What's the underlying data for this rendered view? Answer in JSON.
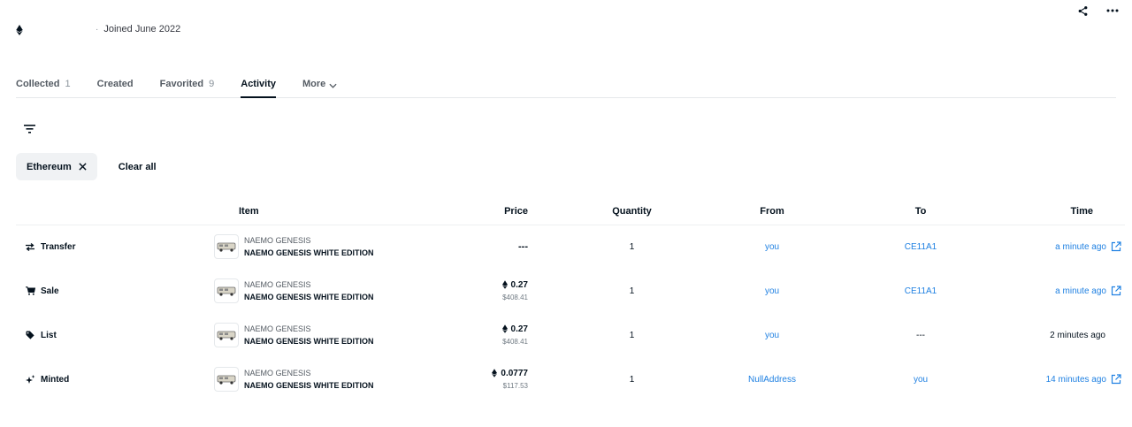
{
  "profile": {
    "joined": "Joined June 2022"
  },
  "tabs": [
    {
      "label": "Collected",
      "count": "1"
    },
    {
      "label": "Created",
      "count": ""
    },
    {
      "label": "Favorited",
      "count": "9"
    },
    {
      "label": "Activity",
      "count": ""
    },
    {
      "label": "More",
      "count": ""
    }
  ],
  "filters": {
    "chip_label": "Ethereum",
    "clear_label": "Clear all"
  },
  "table": {
    "headers": {
      "item": "Item",
      "price": "Price",
      "quantity": "Quantity",
      "from": "From",
      "to": "To",
      "time": "Time"
    },
    "rows": [
      {
        "event": "Transfer",
        "icon": "transfer-icon",
        "collection": "NAEMO GENESIS",
        "item_name": "NAEMO GENESIS WHITE EDITION",
        "price_eth": "---",
        "price_usd": "",
        "quantity": "1",
        "from": "you",
        "to": "CE11A1",
        "time": "a minute ago"
      },
      {
        "event": "Sale",
        "icon": "cart-icon",
        "collection": "NAEMO GENESIS",
        "item_name": "NAEMO GENESIS WHITE EDITION",
        "price_eth": "0.27",
        "price_usd": "$408.41",
        "quantity": "1",
        "from": "you",
        "to": "CE11A1",
        "time": "a minute ago"
      },
      {
        "event": "List",
        "icon": "tag-icon",
        "collection": "NAEMO GENESIS",
        "item_name": "NAEMO GENESIS WHITE EDITION",
        "price_eth": "0.27",
        "price_usd": "$408.41",
        "quantity": "1",
        "from": "you",
        "to": "---",
        "time": "2 minutes ago"
      },
      {
        "event": "Minted",
        "icon": "sparkle-icon",
        "collection": "NAEMO GENESIS",
        "item_name": "NAEMO GENESIS WHITE EDITION",
        "price_eth": "0.0777",
        "price_usd": "$117.53",
        "quantity": "1",
        "from": "NullAddress",
        "to": "you",
        "time": "14 minutes ago"
      }
    ]
  },
  "colors": {
    "link": "#2081e2",
    "text": "#04111d",
    "chip_bg": "#f0f2f4"
  }
}
